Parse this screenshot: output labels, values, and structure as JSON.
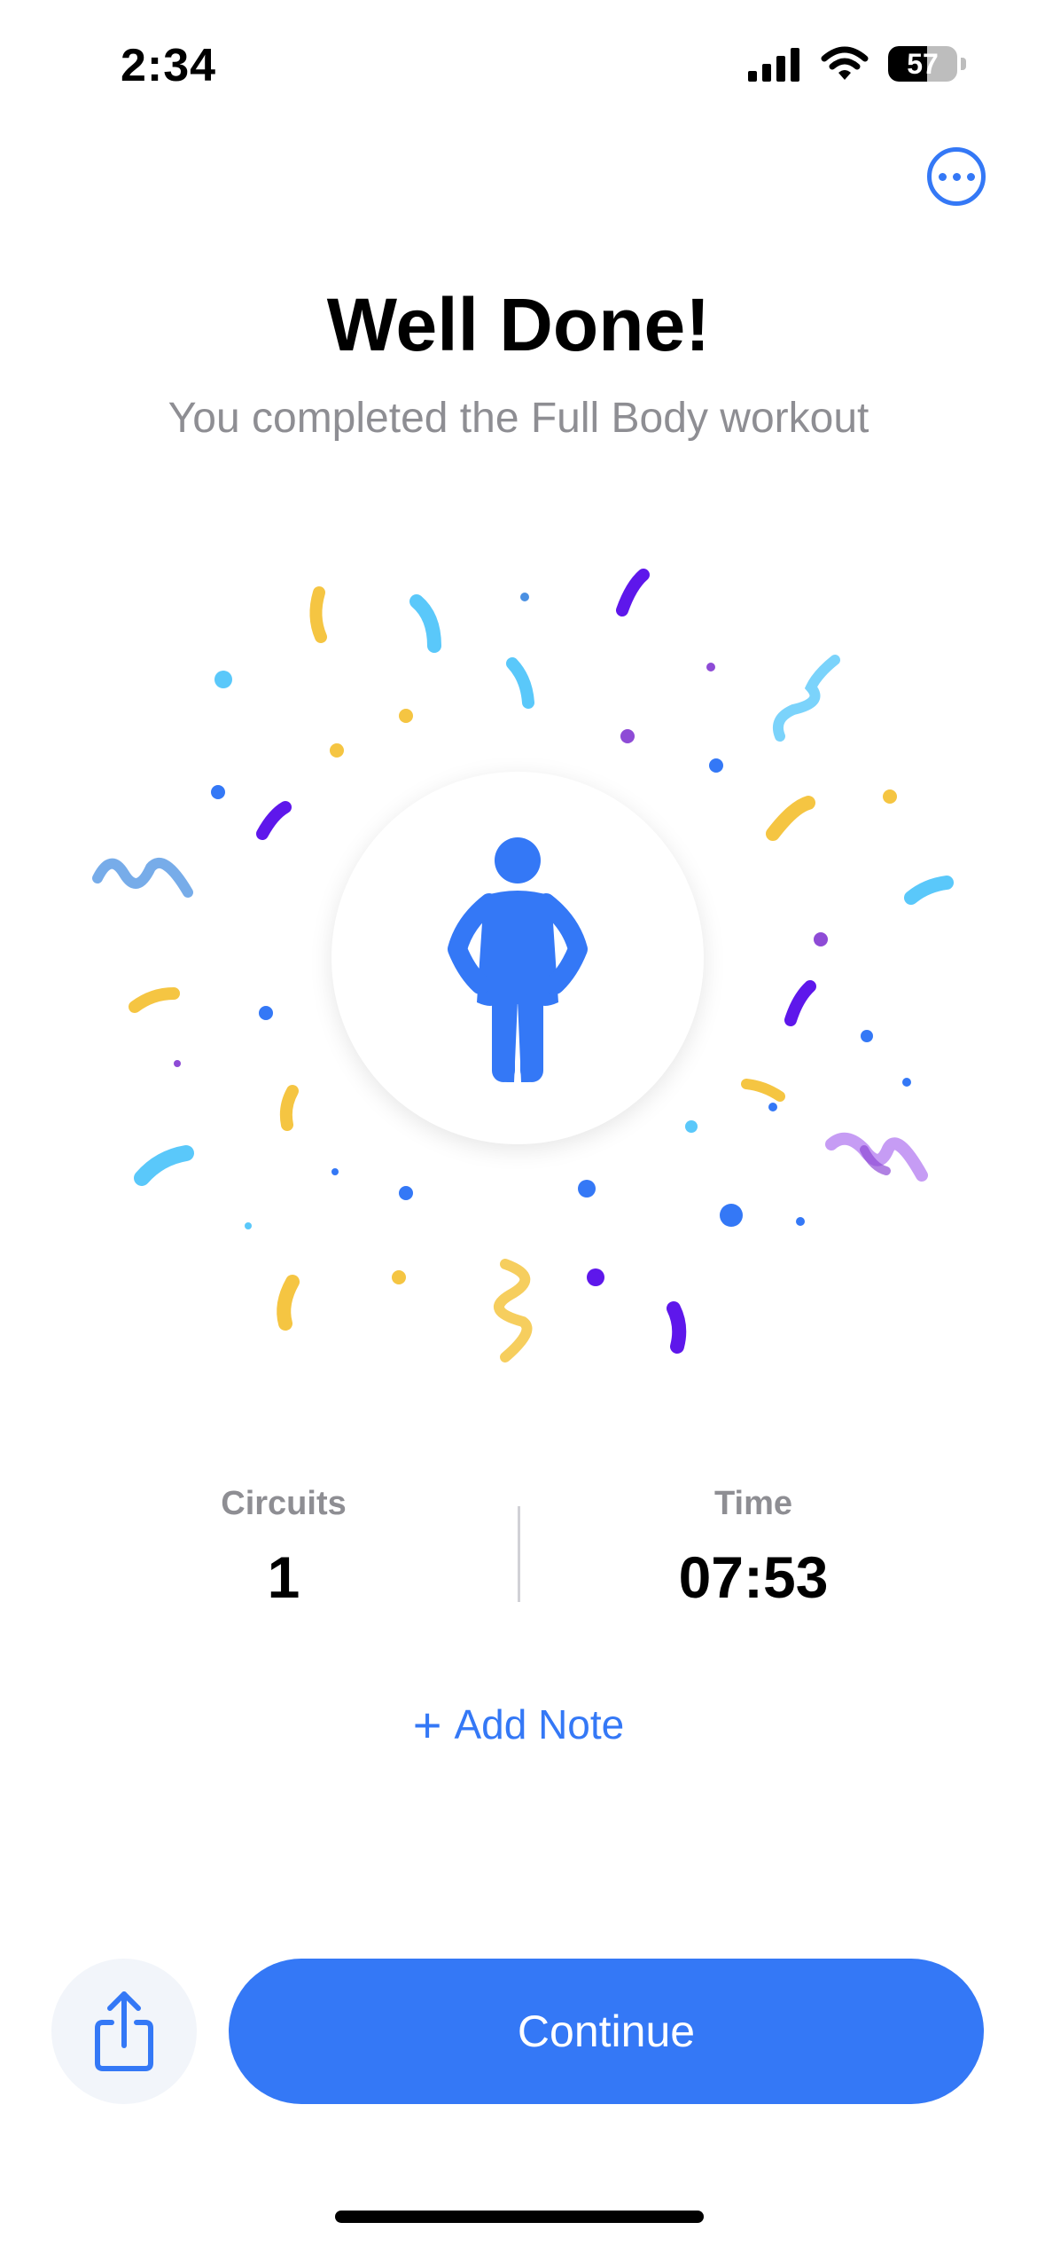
{
  "status_bar": {
    "time": "2:34",
    "battery_level": "57",
    "battery_percent": 57
  },
  "header": {
    "more_icon": "ellipsis-circle-icon"
  },
  "main": {
    "title": "Well Done!",
    "subtitle": "You completed the Full Body workout",
    "figure_icon": "standing-person-icon"
  },
  "stats": {
    "circuits_label": "Circuits",
    "circuits_value": "1",
    "time_label": "Time",
    "time_value": "07:53"
  },
  "add_note": {
    "plus": "+",
    "label": "Add Note"
  },
  "footer": {
    "share_icon": "share-icon",
    "continue_label": "Continue"
  },
  "colors": {
    "accent": "#3478f6",
    "confetti_yellow": "#f5c542",
    "confetti_cyan": "#5ac8fa",
    "confetti_purple": "#5e17eb",
    "confetti_lavender": "#c69cf4"
  }
}
